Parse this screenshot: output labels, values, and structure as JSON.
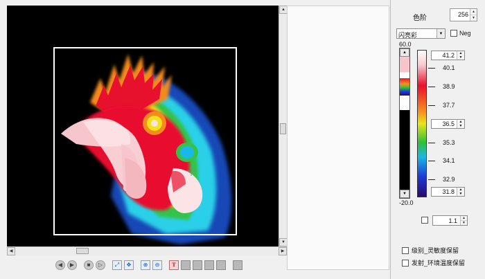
{
  "toolbar": {
    "icons": [
      "first-frame-icon",
      "last-frame-icon",
      "stop-icon",
      "play-icon",
      "fit-icon",
      "move-icon",
      "zoom-in-icon",
      "zoom-out-icon",
      "text-icon",
      "tool-icon",
      "tool-icon",
      "tool-icon",
      "tool-icon",
      "tool-icon"
    ],
    "text_button_glyph": "T"
  },
  "colors": {
    "viewer_bg": "#000000",
    "roi_border": "#ffffff",
    "panel_bg": "#f0f0f0"
  },
  "palette": {
    "levels_label": "色阶",
    "levels_value": "256",
    "scheme_value": "闪亮彩",
    "neg_label": "Neg",
    "neg_checked": false
  },
  "scale": {
    "max_label": "60.0",
    "min_label": "-20.0",
    "upper_marker": "41.2",
    "mid_marker": "36.5",
    "lower_marker": "31.8",
    "ticks": [
      "40.1",
      "38.9",
      "37.7",
      "35.3",
      "34.1",
      "32.9"
    ],
    "fill_upper_fraction": 0.29,
    "fill_lower_fraction": 0.6
  },
  "options": {
    "gain_value": "1.1",
    "gain_checked": false,
    "level_keep_label": "级别_灵敏度保留",
    "emission_keep_label": "发射_环境温度保留"
  }
}
